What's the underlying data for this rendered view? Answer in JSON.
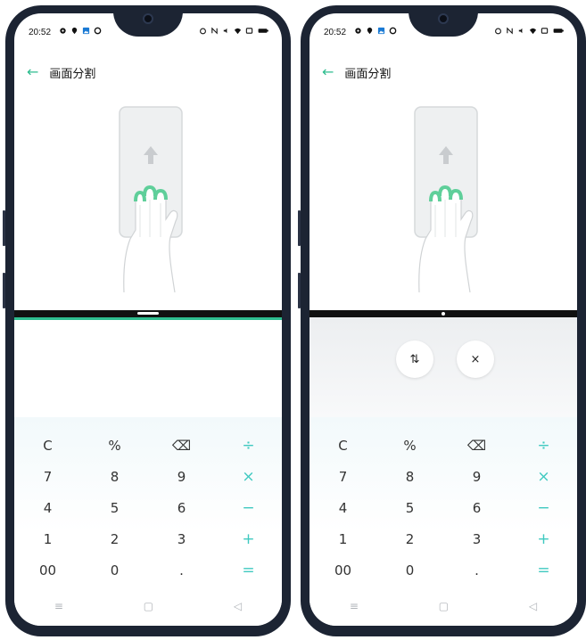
{
  "status": {
    "time": "20:52"
  },
  "page": {
    "title": "画面分割"
  },
  "icons": {
    "back": "back-arrow-icon",
    "swap": "swap-icon",
    "close": "close-icon"
  },
  "colors": {
    "accent": "#2ebd8f",
    "operator": "#3fc9c0",
    "frame": "#1c2433"
  },
  "split_controls": {
    "swap_label": "⇅",
    "close_label": "×"
  },
  "calculator": {
    "rows": [
      [
        "C",
        "%",
        "⌫",
        "÷"
      ],
      [
        "7",
        "8",
        "9",
        "×"
      ],
      [
        "4",
        "5",
        "6",
        "−"
      ],
      [
        "1",
        "2",
        "3",
        "+"
      ],
      [
        "00",
        "0",
        ".",
        "="
      ]
    ]
  },
  "nav": {
    "menu": "≡",
    "home": "▢",
    "back": "◁"
  }
}
